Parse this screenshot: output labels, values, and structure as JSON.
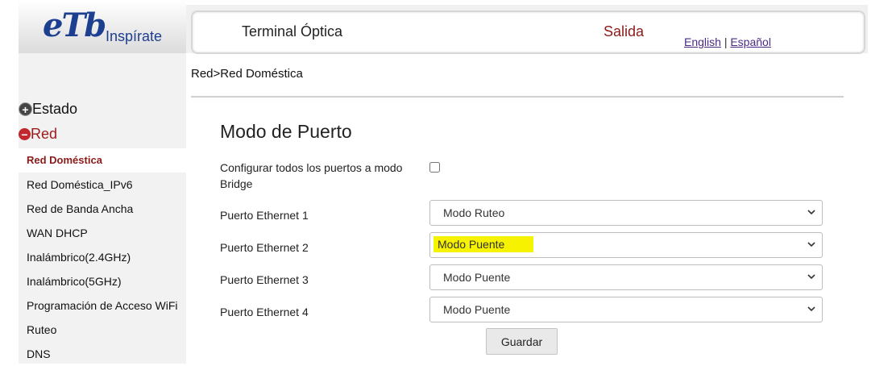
{
  "logo": {
    "mark": "eTb",
    "tagline": "Inspírate"
  },
  "header": {
    "title": "Terminal Óptica",
    "logout": "Salida",
    "lang_english": "English",
    "lang_separator": "|",
    "lang_spanish": "Español"
  },
  "sidebar": {
    "groups": [
      {
        "label": "Estado",
        "state": "collapsed"
      },
      {
        "label": "Red",
        "state": "expanded"
      }
    ],
    "items": [
      {
        "label": "Red Doméstica",
        "active": true
      },
      {
        "label": "Red Doméstica_IPv6"
      },
      {
        "label": "Red de Banda Ancha"
      },
      {
        "label": "WAN DHCP"
      },
      {
        "label": "Inalámbrico(2.4GHz)"
      },
      {
        "label": "Inalámbrico(5GHz)"
      },
      {
        "label": "Programación de Acceso WiFi"
      },
      {
        "label": "Ruteo"
      },
      {
        "label": "DNS"
      }
    ]
  },
  "breadcrumb": "Red>Red Doméstica",
  "main": {
    "section_title": "Modo de Puerto",
    "bridge_all_label": "Configurar todos los puertos a modo Bridge",
    "bridge_all_checked": false,
    "ports": [
      {
        "label": "Puerto Ethernet 1",
        "value": "Modo Ruteo"
      },
      {
        "label": "Puerto Ethernet 2",
        "value": "Modo Puente",
        "highlighted": true
      },
      {
        "label": "Puerto Ethernet 3",
        "value": "Modo Puente"
      },
      {
        "label": "Puerto Ethernet 4",
        "value": "Modo Puente"
      }
    ],
    "save_label": "Guardar"
  },
  "colors": {
    "brand_blue": "#1d3f8f",
    "brand_red": "#8b1a1a",
    "highlight": "#f7f200"
  }
}
